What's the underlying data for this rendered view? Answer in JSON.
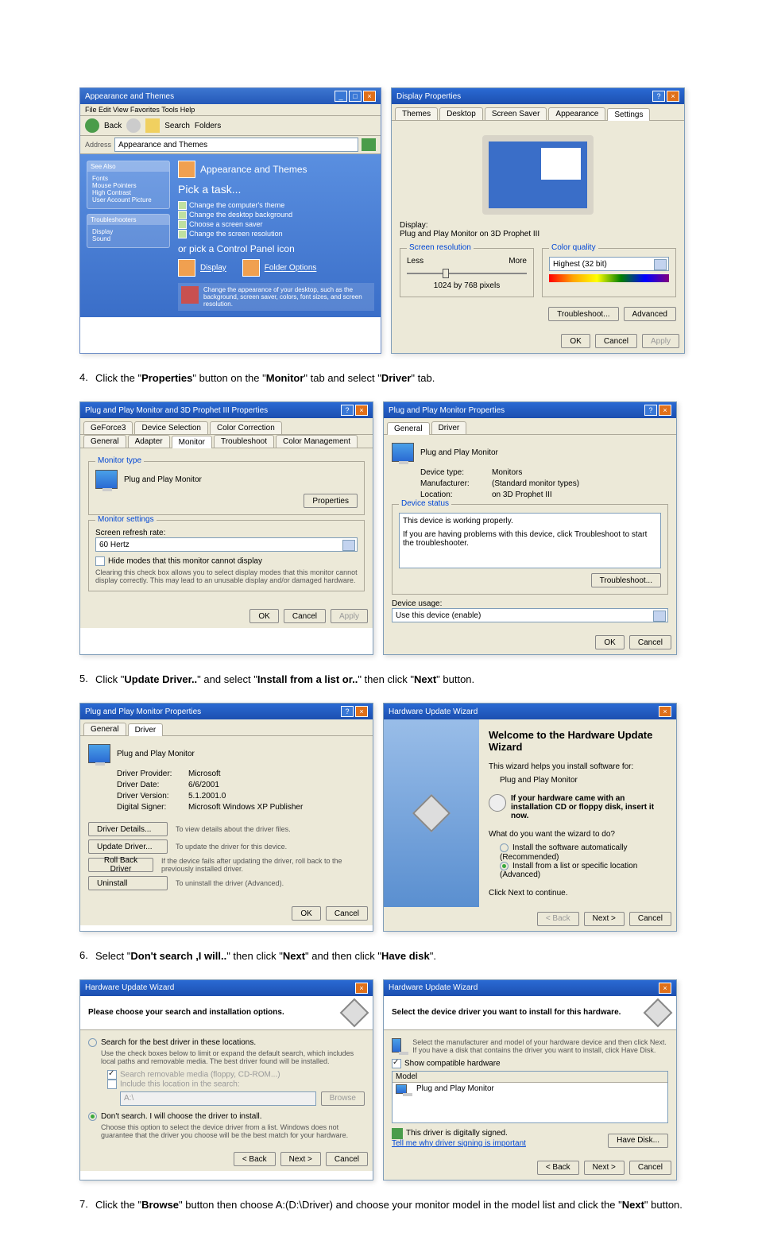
{
  "steps": {
    "s4": "Click the \"Properties\" button on the \"Monitor\" tab and select \"Driver\" tab.",
    "s5": "Click \"Update Driver..\" and select \"Install from a list or..\" then click \"Next\" button.",
    "s6": "Select \"Don't search ,I will..\" then click \"Next\" and then click \"Have disk\".",
    "s7": "Click the \"Browse\" button then choose A:(D:\\Driver) and choose your monitor model in the model list and click the \"Next\" button."
  },
  "cp": {
    "title": "Appearance and Themes",
    "toolbar": {
      "back": "Back",
      "search": "Search",
      "folders": "Folders"
    },
    "address_label": "Address",
    "address": "Appearance and Themes",
    "side1_hdr": "See Also",
    "side1_items": [
      "Fonts",
      "Mouse Pointers",
      "High Contrast",
      "User Account Picture"
    ],
    "side2_hdr": "Troubleshooters",
    "side2_items": [
      "Display",
      "Sound"
    ],
    "heading": "Appearance and Themes",
    "pick": "Pick a task...",
    "tasks": [
      "Change the computer's theme",
      "Change the desktop background",
      "Choose a screen saver",
      "Change the screen resolution"
    ],
    "or": "or pick a Control Panel icon",
    "icon1": "Display",
    "icon2": "Folder Options",
    "tip": "Change the appearance of your desktop, such as the background, screen saver, colors, font sizes, and screen resolution."
  },
  "disp": {
    "title": "Display Properties",
    "tabs": [
      "Themes",
      "Desktop",
      "Screen Saver",
      "Appearance",
      "Settings"
    ],
    "active_tab": "Settings",
    "display_label": "Display:",
    "display_value": "Plug and Play Monitor on 3D Prophet III",
    "res_label": "Screen resolution",
    "less": "Less",
    "more": "More",
    "res_value": "1024 by 768 pixels",
    "cq_label": "Color quality",
    "cq_value": "Highest (32 bit)",
    "troubleshoot": "Troubleshoot...",
    "advanced": "Advanced",
    "ok": "OK",
    "cancel": "Cancel",
    "apply": "Apply"
  },
  "mon3d": {
    "title": "Plug and Play Monitor and 3D Prophet III Properties",
    "tabs_row1": [
      "GeForce3",
      "Device Selection",
      "Color Correction"
    ],
    "tabs_row2": [
      "General",
      "Adapter",
      "Monitor",
      "Troubleshoot",
      "Color Management"
    ],
    "active_tab": "Monitor",
    "g1": "Monitor type",
    "g1_val": "Plug and Play Monitor",
    "properties": "Properties",
    "g2": "Monitor settings",
    "refresh_label": "Screen refresh rate:",
    "refresh_val": "60 Hertz",
    "hide_modes": "Hide modes that this monitor cannot display",
    "hide_desc": "Clearing this check box allows you to select display modes that this monitor cannot display correctly. This may lead to an unusable display and/or damaged hardware.",
    "ok": "OK",
    "cancel": "Cancel",
    "apply": "Apply"
  },
  "pnp_gen": {
    "title": "Plug and Play Monitor Properties",
    "tabs": [
      "General",
      "Driver"
    ],
    "active_tab": "General",
    "name": "Plug and Play Monitor",
    "k_type": "Device type:",
    "v_type": "Monitors",
    "k_mfr": "Manufacturer:",
    "v_mfr": "(Standard monitor types)",
    "k_loc": "Location:",
    "v_loc": "on 3D Prophet III",
    "status_g": "Device status",
    "status_line1": "This device is working properly.",
    "status_line2": "If you are having problems with this device, click Troubleshoot to start the troubleshooter.",
    "troubleshoot": "Troubleshoot...",
    "usage_label": "Device usage:",
    "usage_val": "Use this device (enable)",
    "ok": "OK",
    "cancel": "Cancel"
  },
  "pnp_drv": {
    "title": "Plug and Play Monitor Properties",
    "tabs": [
      "General",
      "Driver"
    ],
    "active_tab": "Driver",
    "name": "Plug and Play Monitor",
    "k_prov": "Driver Provider:",
    "v_prov": "Microsoft",
    "k_date": "Driver Date:",
    "v_date": "6/6/2001",
    "k_ver": "Driver Version:",
    "v_ver": "5.1.2001.0",
    "k_sign": "Digital Signer:",
    "v_sign": "Microsoft Windows XP Publisher",
    "btn_det": "Driver Details...",
    "desc_det": "To view details about the driver files.",
    "btn_upd": "Update Driver...",
    "desc_upd": "To update the driver for this device.",
    "btn_roll": "Roll Back Driver",
    "desc_roll": "If the device fails after updating the driver, roll back to the previously installed driver.",
    "btn_unin": "Uninstall",
    "desc_unin": "To uninstall the driver (Advanced).",
    "ok": "OK",
    "cancel": "Cancel"
  },
  "wiz1": {
    "title": "Hardware Update Wizard",
    "heading": "Welcome to the Hardware Update Wizard",
    "line1": "This wizard helps you install software for:",
    "device": "Plug and Play Monitor",
    "cd_note": "If your hardware came with an installation CD or floppy disk, insert it now.",
    "q": "What do you want the wizard to do?",
    "opt_a": "Install the software automatically (Recommended)",
    "opt_b": "Install from a list or specific location (Advanced)",
    "cont": "Click Next to continue.",
    "back": "< Back",
    "next": "Next >",
    "cancel": "Cancel"
  },
  "wiz2": {
    "title": "Hardware Update Wizard",
    "heading": "Please choose your search and installation options.",
    "opt_a": "Search for the best driver in these locations.",
    "opt_a_desc": "Use the check boxes below to limit or expand the default search, which includes local paths and removable media. The best driver found will be installed.",
    "chk1": "Search removable media (floppy, CD-ROM...)",
    "chk2": "Include this location in the search:",
    "path": "A:\\",
    "browse": "Browse",
    "opt_b": "Don't search. I will choose the driver to install.",
    "opt_b_desc": "Choose this option to select the device driver from a list. Windows does not guarantee that the driver you choose will be the best match for your hardware.",
    "back": "< Back",
    "next": "Next >",
    "cancel": "Cancel"
  },
  "wiz3": {
    "title": "Hardware Update Wizard",
    "heading": "Select the device driver you want to install for this hardware.",
    "desc": "Select the manufacturer and model of your hardware device and then click Next. If you have a disk that contains the driver you want to install, click Have Disk.",
    "compat": "Show compatible hardware",
    "model_hdr": "Model",
    "model": "Plug and Play Monitor",
    "signed": "This driver is digitally signed.",
    "tell": "Tell me why driver signing is important",
    "have_disk": "Have Disk...",
    "back": "< Back",
    "next": "Next >",
    "cancel": "Cancel"
  }
}
